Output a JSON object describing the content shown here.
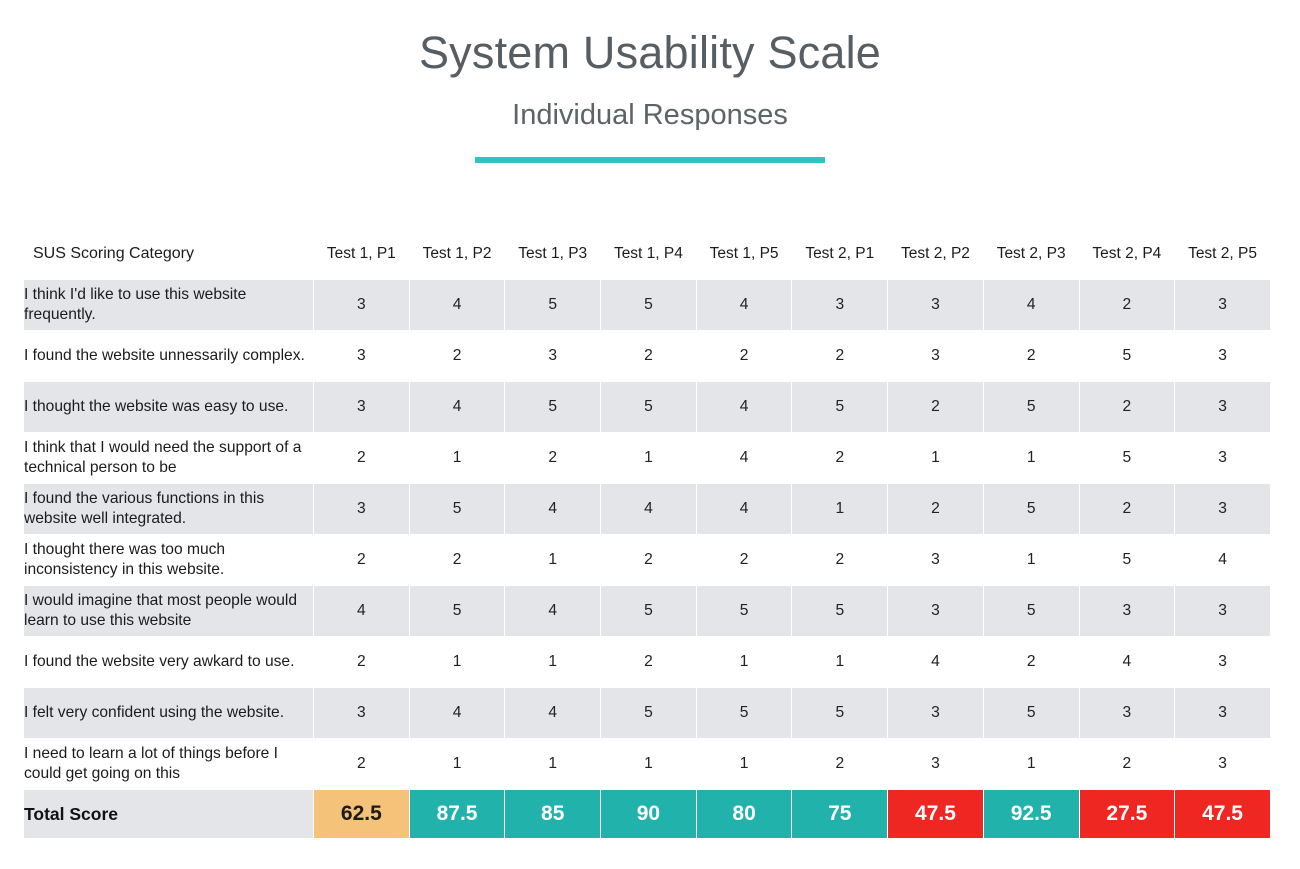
{
  "header": {
    "title": "System Usability Scale",
    "subtitle": "Individual Responses",
    "accent_color": "#2ec4c6"
  },
  "colors": {
    "teal": "#21b2ac",
    "red": "#ee2722",
    "orange": "#f4c279",
    "row_stripe": "#e3e5e8",
    "title_gray": "#575e63"
  },
  "chart_data": {
    "type": "table",
    "title": "System Usability Scale",
    "subtitle": "Individual Responses",
    "columns": [
      "SUS Scoring Category",
      "Test 1, P1",
      "Test 1, P2",
      "Test 1, P3",
      "Test 1, P4",
      "Test 1, P5",
      "Test 2, P1",
      "Test 2, P2",
      "Test 2, P3",
      "Test 2, P4",
      "Test 2, P5"
    ],
    "rows": [
      {
        "label": "I think I'd like to use this website frequently.",
        "values": [
          3,
          4,
          5,
          5,
          4,
          3,
          3,
          4,
          2,
          3
        ]
      },
      {
        "label": "I found the website unnessarily complex.",
        "values": [
          3,
          2,
          3,
          2,
          2,
          2,
          3,
          2,
          5,
          3
        ]
      },
      {
        "label": "I thought the website was easy to use.",
        "values": [
          3,
          4,
          5,
          5,
          4,
          5,
          2,
          5,
          2,
          3
        ]
      },
      {
        "label": "I think that I would need the support of a technical person to be",
        "values": [
          2,
          1,
          2,
          1,
          4,
          2,
          1,
          1,
          5,
          3
        ]
      },
      {
        "label": "I found the various functions in this website well integrated.",
        "values": [
          3,
          5,
          4,
          4,
          4,
          1,
          2,
          5,
          2,
          3
        ]
      },
      {
        "label": "I thought there was too much inconsistency in this website.",
        "values": [
          2,
          2,
          1,
          2,
          2,
          2,
          3,
          1,
          5,
          4
        ]
      },
      {
        "label": "I would imagine that most people would learn to use this website",
        "values": [
          4,
          5,
          4,
          5,
          5,
          5,
          3,
          5,
          3,
          3
        ]
      },
      {
        "label": "I found the website very awkard to use.",
        "values": [
          2,
          1,
          1,
          2,
          1,
          1,
          4,
          2,
          4,
          3
        ]
      },
      {
        "label": "I felt very confident using the website.",
        "values": [
          3,
          4,
          4,
          5,
          5,
          5,
          3,
          5,
          3,
          3
        ]
      },
      {
        "label": "I need to learn a lot of things before I could get going on this",
        "values": [
          2,
          1,
          1,
          1,
          1,
          2,
          3,
          1,
          2,
          3
        ]
      }
    ],
    "total_row": {
      "label": "Total Score",
      "values": [
        "62.5",
        "87.5",
        "85",
        "90",
        "80",
        "75",
        "47.5",
        "92.5",
        "27.5",
        "47.5"
      ],
      "colors": [
        "orange",
        "teal",
        "teal",
        "teal",
        "teal",
        "teal",
        "red",
        "teal",
        "red",
        "red"
      ]
    }
  }
}
